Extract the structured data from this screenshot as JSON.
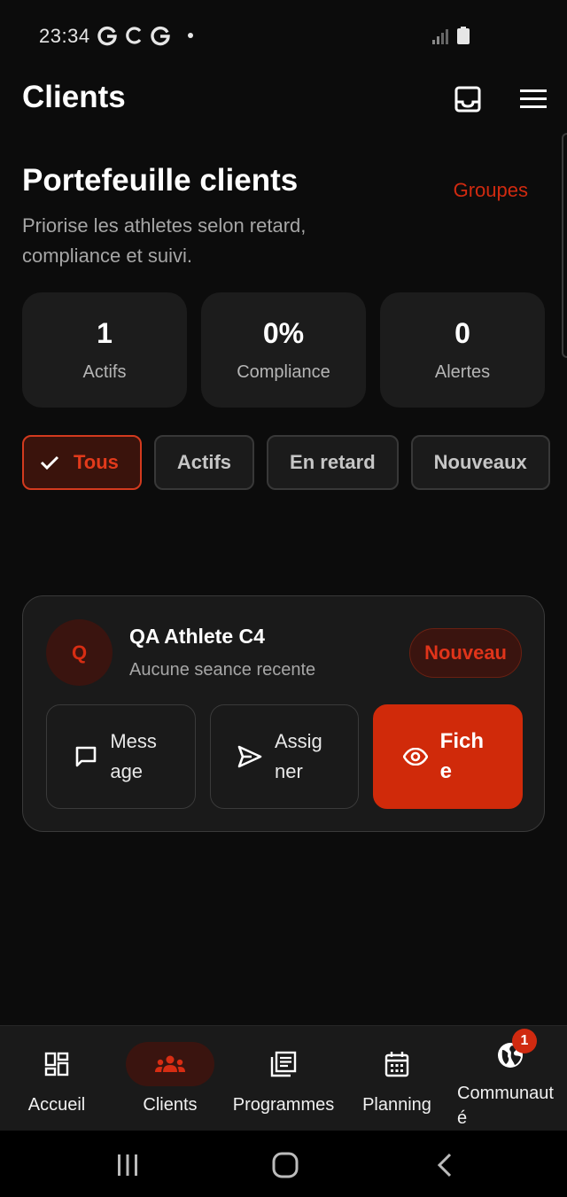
{
  "status_bar": {
    "time": "23:34"
  },
  "app_bar": {
    "title": "Clients"
  },
  "section": {
    "title": "Portefeuille clients",
    "groups_link": "Groupes",
    "subtitle": "Priorise les athletes selon retard, compliance et suivi."
  },
  "stats": [
    {
      "value": "1",
      "label": "Actifs"
    },
    {
      "value": "0%",
      "label": "Compliance"
    },
    {
      "value": "0",
      "label": "Alertes"
    }
  ],
  "filters": [
    {
      "label": "Tous",
      "selected": true
    },
    {
      "label": "Actifs",
      "selected": false
    },
    {
      "label": "En retard",
      "selected": false
    },
    {
      "label": "Nouveaux",
      "selected": false
    }
  ],
  "client": {
    "initial": "Q",
    "name": "QA Athlete C4",
    "meta": "Aucune seance recente",
    "badge": "Nouveau",
    "actions": {
      "message": "Message",
      "assign": "Assigner",
      "profile": "Fiche"
    }
  },
  "bottom_nav": {
    "items": [
      {
        "label": "Accueil",
        "icon": "dashboard-icon"
      },
      {
        "label": "Clients",
        "icon": "groups-icon",
        "active": true
      },
      {
        "label": "Programmes",
        "icon": "library-icon"
      },
      {
        "label": "Planning",
        "icon": "calendar-icon"
      },
      {
        "label": "Communauté",
        "icon": "globe-icon",
        "badge": "1"
      }
    ]
  },
  "colors": {
    "accent": "#d02a0a",
    "background": "#0c0c0c",
    "card": "#1c1c1c"
  }
}
